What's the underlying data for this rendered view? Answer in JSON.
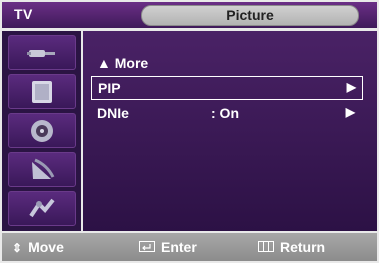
{
  "header": {
    "source_label": "TV",
    "menu_title": "Picture"
  },
  "sidebar": {
    "items": [
      {
        "icon": "antenna-icon"
      },
      {
        "icon": "picture-icon"
      },
      {
        "icon": "speaker-icon"
      },
      {
        "icon": "satellite-icon"
      },
      {
        "icon": "setup-icon"
      }
    ]
  },
  "menu": {
    "items": [
      {
        "label": "▲ More",
        "value": "",
        "arrow": ""
      },
      {
        "label": "PIP",
        "value": "",
        "arrow": "▶"
      },
      {
        "label": "DNIe",
        "value": ":  On",
        "arrow": "▶"
      }
    ],
    "selected_index": 1
  },
  "footer": {
    "move_label": "Move",
    "enter_label": "Enter",
    "return_label": "Return"
  },
  "colors": {
    "title_bar": "#3f1a5a",
    "content_bg": "#2c1145",
    "footer_bg": "#9a9a9a"
  }
}
